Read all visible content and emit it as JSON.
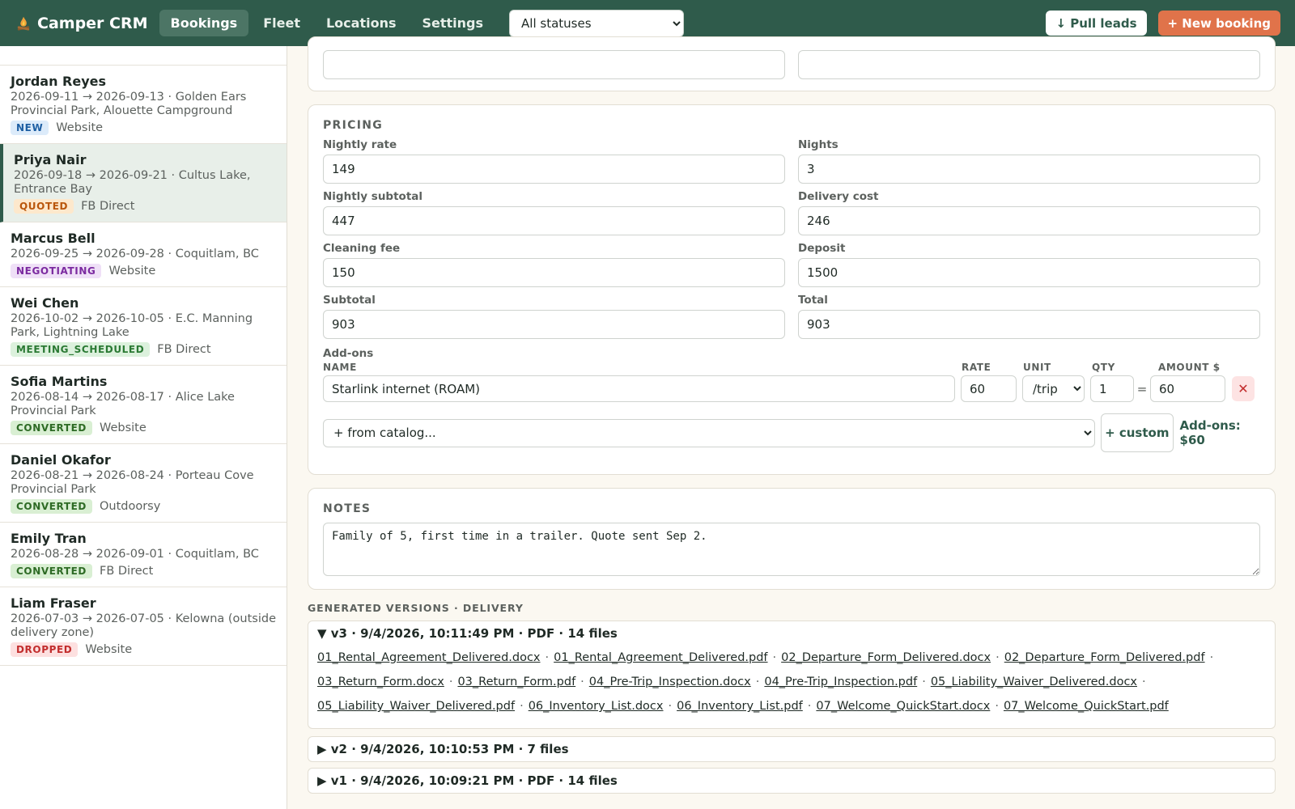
{
  "header": {
    "brand": "Camper CRM",
    "brand_icon": "campfire-icon",
    "tabs": [
      {
        "label": "Bookings",
        "active": true
      },
      {
        "label": "Fleet",
        "active": false
      },
      {
        "label": "Locations",
        "active": false
      },
      {
        "label": "Settings",
        "active": false
      }
    ],
    "status_filter": "All statuses",
    "pull_leads": "↓ Pull leads",
    "new_booking": "+ New booking",
    "colors": {
      "bar": "#2f5b4b",
      "accent": "#e0734a"
    }
  },
  "sidebar": {
    "bookings": [
      {
        "name": "Jordan Reyes",
        "meta": "2026-09-11 → 2026-09-13 · Golden Ears Provincial Park, Alouette Campground",
        "status": "NEW",
        "status_class": "new",
        "source": "Website"
      },
      {
        "name": "Priya Nair",
        "meta": "2026-09-18 → 2026-09-21 · Cultus Lake, Entrance Bay",
        "status": "QUOTED",
        "status_class": "quoted",
        "source": "FB Direct",
        "selected": true
      },
      {
        "name": "Marcus Bell",
        "meta": "2026-09-25 → 2026-09-28 · Coquitlam, BC",
        "status": "NEGOTIATING",
        "status_class": "negotiating",
        "source": "Website"
      },
      {
        "name": "Wei Chen",
        "meta": "2026-10-02 → 2026-10-05 · E.C. Manning Park, Lightning Lake",
        "status": "MEETING_SCHEDULED",
        "status_class": "meeting",
        "source": "FB Direct"
      },
      {
        "name": "Sofia Martins",
        "meta": "2026-08-14 → 2026-08-17 · Alice Lake Provincial Park",
        "status": "CONVERTED",
        "status_class": "converted",
        "source": "Website"
      },
      {
        "name": "Daniel Okafor",
        "meta": "2026-08-21 → 2026-08-24 · Porteau Cove Provincial Park",
        "status": "CONVERTED",
        "status_class": "converted",
        "source": "Outdoorsy"
      },
      {
        "name": "Emily Tran",
        "meta": "2026-08-28 → 2026-09-01 · Coquitlam, BC",
        "status": "CONVERTED",
        "status_class": "converted",
        "source": "FB Direct"
      },
      {
        "name": "Liam Fraser",
        "meta": "2026-07-03 → 2026-07-05 · Kelowna (outside delivery zone)",
        "status": "DROPPED",
        "status_class": "dropped",
        "source": "Website"
      }
    ]
  },
  "pricing": {
    "title": "PRICING",
    "nightly_rate": {
      "label": "Nightly rate",
      "value": "149"
    },
    "nights": {
      "label": "Nights",
      "value": "3"
    },
    "nightly_subtotal": {
      "label": "Nightly subtotal",
      "value": "447"
    },
    "delivery_cost": {
      "label": "Delivery cost",
      "value": "246"
    },
    "cleaning_fee": {
      "label": "Cleaning fee",
      "value": "150"
    },
    "deposit": {
      "label": "Deposit",
      "value": "1500"
    },
    "subtotal": {
      "label": "Subtotal",
      "value": "903"
    },
    "total": {
      "label": "Total",
      "value": "903"
    },
    "addons": {
      "label": "Add-ons",
      "col_name": "NAME",
      "col_rate": "RATE",
      "col_unit": "UNIT",
      "col_qty": "QTY",
      "col_amount": "AMOUNT $",
      "item": {
        "name": "Starlink internet (ROAM)",
        "rate": "60",
        "unit": "/trip",
        "qty": "1",
        "amount": "60"
      },
      "catalog": "+ from catalog...",
      "custom_button": "+ custom",
      "total_label": "Add-ons:",
      "total_value": "$60"
    }
  },
  "notes": {
    "title": "NOTES",
    "text": "Family of 5, first time in a trailer. Quote sent Sep 2."
  },
  "generated": {
    "title": "GENERATED VERSIONS · DELIVERY",
    "versions": [
      {
        "label": "▼ v3 · 9/4/2026, 10:11:49 PM · PDF · 14 files",
        "open": true,
        "files": [
          "01_Rental_Agreement_Delivered.docx",
          "01_Rental_Agreement_Delivered.pdf",
          "02_Departure_Form_Delivered.docx",
          "02_Departure_Form_Delivered.pdf",
          "03_Return_Form.docx",
          "03_Return_Form.pdf",
          "04_Pre-Trip_Inspection.docx",
          "04_Pre-Trip_Inspection.pdf",
          "05_Liability_Waiver_Delivered.docx",
          "05_Liability_Waiver_Delivered.pdf",
          "06_Inventory_List.docx",
          "06_Inventory_List.pdf",
          "07_Welcome_QuickStart.docx",
          "07_Welcome_QuickStart.pdf"
        ]
      },
      {
        "label": "▶ v2 · 9/4/2026, 10:10:53 PM · 7 files",
        "open": false
      },
      {
        "label": "▶ v1 · 9/4/2026, 10:09:21 PM · PDF · 14 files",
        "open": false
      }
    ]
  }
}
